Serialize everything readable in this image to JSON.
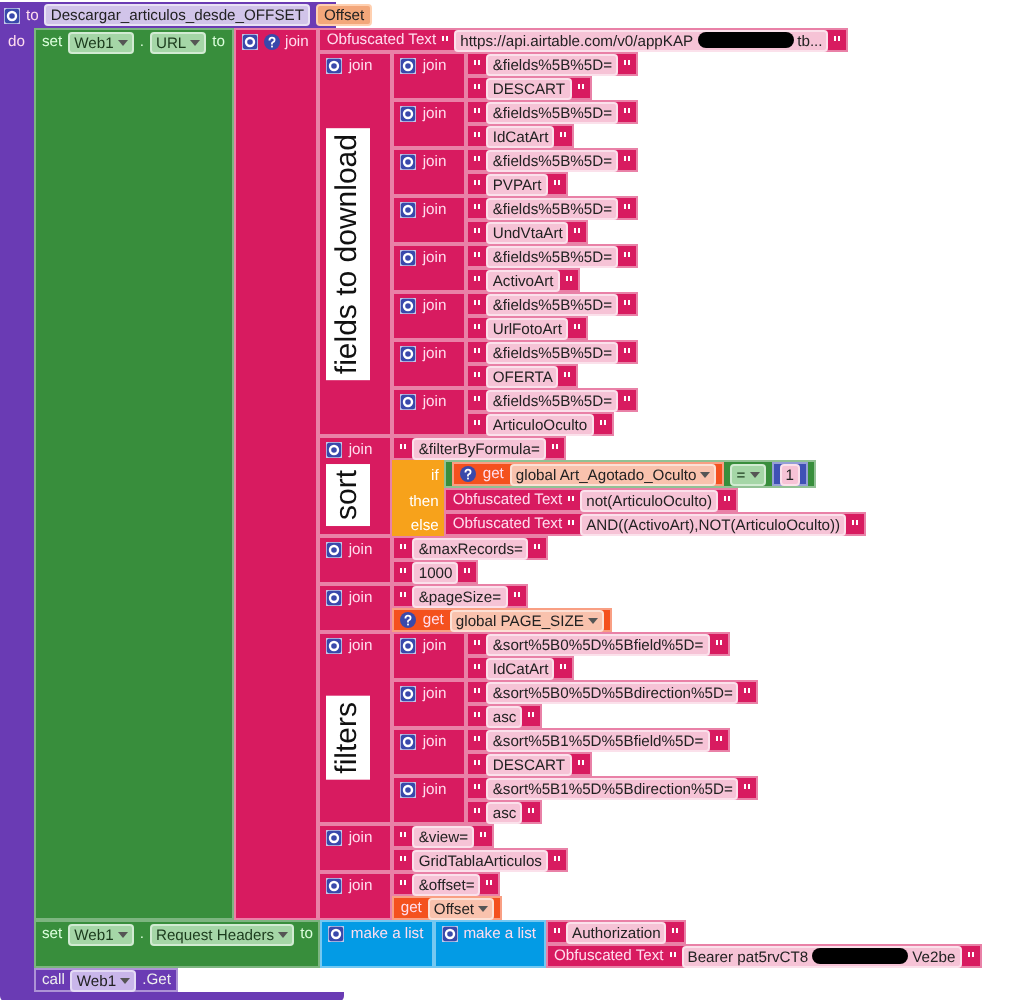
{
  "procedure": {
    "kw_to": "to",
    "name": "Descargar_articulos_desde_OFFSET",
    "params": [
      "Offset"
    ],
    "kw_do": "do",
    "statements": [
      {
        "kind": "set",
        "kw_set": "set",
        "component": "Web1",
        "dot": ".",
        "property": "URL",
        "kw_to": "to",
        "value": {
          "kind": "join",
          "label": "join",
          "help": true,
          "inputs": [
            {
              "kind": "obfuscated",
              "label": "Obfuscated Text",
              "parts": [
                "https://api.airtable.com/v0/appKAP",
                "tb..."
              ]
            },
            {
              "kind": "join",
              "label": "join",
              "comment": "fields to download",
              "inputs": [
                {
                  "kind": "join",
                  "label": "join",
                  "inputs": [
                    {
                      "kind": "text",
                      "value": "&fields%5B%5D="
                    },
                    {
                      "kind": "text",
                      "value": "DESCART"
                    }
                  ]
                },
                {
                  "kind": "join",
                  "label": "join",
                  "inputs": [
                    {
                      "kind": "text",
                      "value": "&fields%5B%5D="
                    },
                    {
                      "kind": "text",
                      "value": "IdCatArt"
                    }
                  ]
                },
                {
                  "kind": "join",
                  "label": "join",
                  "inputs": [
                    {
                      "kind": "text",
                      "value": "&fields%5B%5D="
                    },
                    {
                      "kind": "text",
                      "value": "PVPArt"
                    }
                  ]
                },
                {
                  "kind": "join",
                  "label": "join",
                  "inputs": [
                    {
                      "kind": "text",
                      "value": "&fields%5B%5D="
                    },
                    {
                      "kind": "text",
                      "value": "UndVtaArt"
                    }
                  ]
                },
                {
                  "kind": "join",
                  "label": "join",
                  "inputs": [
                    {
                      "kind": "text",
                      "value": "&fields%5B%5D="
                    },
                    {
                      "kind": "text",
                      "value": "ActivoArt"
                    }
                  ]
                },
                {
                  "kind": "join",
                  "label": "join",
                  "inputs": [
                    {
                      "kind": "text",
                      "value": "&fields%5B%5D="
                    },
                    {
                      "kind": "text",
                      "value": "UrlFotoArt"
                    }
                  ]
                },
                {
                  "kind": "join",
                  "label": "join",
                  "inputs": [
                    {
                      "kind": "text",
                      "value": "&fields%5B%5D="
                    },
                    {
                      "kind": "text",
                      "value": "OFERTA"
                    }
                  ]
                },
                {
                  "kind": "join",
                  "label": "join",
                  "inputs": [
                    {
                      "kind": "text",
                      "value": "&fields%5B%5D="
                    },
                    {
                      "kind": "text",
                      "value": "ArticuloOculto"
                    }
                  ]
                }
              ]
            },
            {
              "kind": "join",
              "label": "join",
              "comment": "sort",
              "inputs": [
                {
                  "kind": "text",
                  "value": "&filterByFormula="
                },
                {
                  "kind": "if",
                  "keywords": [
                    "if",
                    "then",
                    "else"
                  ],
                  "inputs": [
                    {
                      "kind": "compare",
                      "left": {
                        "kind": "get",
                        "label": "get",
                        "help": true,
                        "variable": "global Art_Agotado_Oculto"
                      },
                      "op": "=",
                      "right": {
                        "kind": "number",
                        "value": "1"
                      }
                    },
                    {
                      "kind": "obfuscated",
                      "label": "Obfuscated Text",
                      "parts": [
                        "not(ArticuloOculto)"
                      ]
                    },
                    {
                      "kind": "obfuscated",
                      "label": "Obfuscated Text",
                      "parts": [
                        "AND((ActivoArt),NOT(ArticuloOculto))"
                      ]
                    }
                  ]
                }
              ]
            },
            {
              "kind": "join",
              "label": "join",
              "inputs": [
                {
                  "kind": "text",
                  "value": "&maxRecords="
                },
                {
                  "kind": "text",
                  "value": "1000"
                }
              ]
            },
            {
              "kind": "join",
              "label": "join",
              "inputs": [
                {
                  "kind": "text",
                  "value": "&pageSize="
                },
                {
                  "kind": "get",
                  "label": "get",
                  "help": true,
                  "variable": "global PAGE_SIZE"
                }
              ]
            },
            {
              "kind": "join",
              "label": "join",
              "comment": "filters",
              "inputs": [
                {
                  "kind": "join",
                  "label": "join",
                  "inputs": [
                    {
                      "kind": "text",
                      "value": "&sort%5B0%5D%5Bfield%5D="
                    },
                    {
                      "kind": "text",
                      "value": "IdCatArt"
                    }
                  ]
                },
                {
                  "kind": "join",
                  "label": "join",
                  "inputs": [
                    {
                      "kind": "text",
                      "value": "&sort%5B0%5D%5Bdirection%5D="
                    },
                    {
                      "kind": "text",
                      "value": "asc"
                    }
                  ]
                },
                {
                  "kind": "join",
                  "label": "join",
                  "inputs": [
                    {
                      "kind": "text",
                      "value": "&sort%5B1%5D%5Bfield%5D="
                    },
                    {
                      "kind": "text",
                      "value": "DESCART"
                    }
                  ]
                },
                {
                  "kind": "join",
                  "label": "join",
                  "inputs": [
                    {
                      "kind": "text",
                      "value": "&sort%5B1%5D%5Bdirection%5D="
                    },
                    {
                      "kind": "text",
                      "value": "asc"
                    }
                  ]
                }
              ]
            },
            {
              "kind": "join",
              "label": "join",
              "inputs": [
                {
                  "kind": "text",
                  "value": "&view="
                },
                {
                  "kind": "text",
                  "value": "GridTablaArticulos"
                }
              ]
            },
            {
              "kind": "join",
              "label": "join",
              "inputs": [
                {
                  "kind": "text",
                  "value": "&offset="
                },
                {
                  "kind": "get",
                  "label": "get",
                  "variable": "Offset"
                }
              ]
            }
          ]
        }
      },
      {
        "kind": "set",
        "kw_set": "set",
        "component": "Web1",
        "dot": ".",
        "property": "Request Headers",
        "kw_to": "to",
        "value": {
          "kind": "list",
          "label": "make a list",
          "inputs": [
            {
              "kind": "list",
              "label": "make a list",
              "inputs": [
                {
                  "kind": "text",
                  "value": "Authorization"
                },
                {
                  "kind": "obfuscated",
                  "label": "Obfuscated Text",
                  "parts": [
                    "Bearer pat5rvCT8",
                    "Ve2be"
                  ]
                }
              ]
            }
          ]
        }
      },
      {
        "kind": "call",
        "kw_call": "call",
        "component": "Web1",
        "method": ".Get"
      }
    ]
  }
}
